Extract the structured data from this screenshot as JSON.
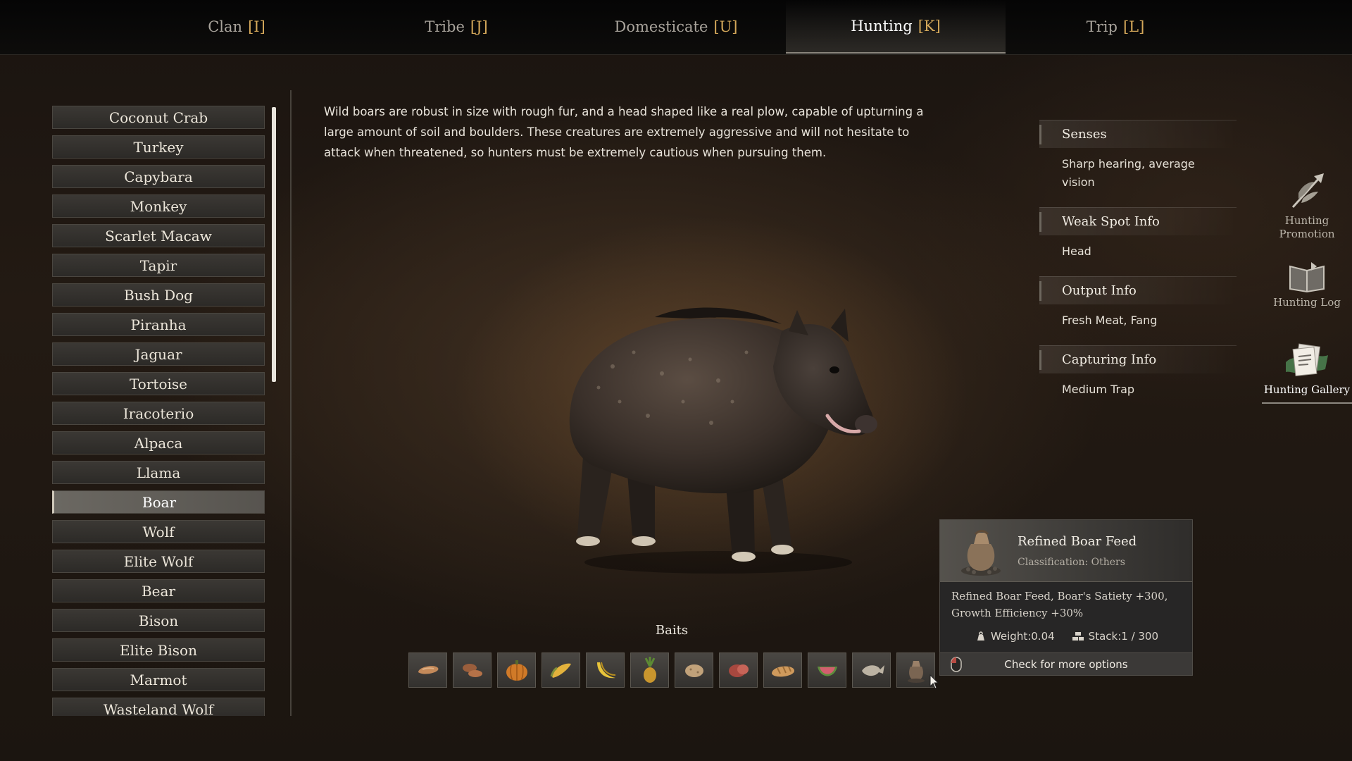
{
  "tabs": [
    {
      "label": "Clan",
      "key": "[I]",
      "active": false
    },
    {
      "label": "Tribe",
      "key": "[J]",
      "active": false
    },
    {
      "label": "Domesticate",
      "key": "[U]",
      "active": false
    },
    {
      "label": "Hunting",
      "key": "[K]",
      "active": true
    },
    {
      "label": "Trip",
      "key": "[L]",
      "active": false
    }
  ],
  "animals": [
    "Coconut Crab",
    "Turkey",
    "Capybara",
    "Monkey",
    "Scarlet Macaw",
    "Tapir",
    "Bush Dog",
    "Piranha",
    "Jaguar",
    "Tortoise",
    "Iracoterio",
    "Alpaca",
    "Llama",
    "Boar",
    "Wolf",
    "Elite Wolf",
    "Bear",
    "Bison",
    "Elite Bison",
    "Marmot",
    "Wasteland Wolf"
  ],
  "selected_animal": "Boar",
  "description": "Wild boars are robust in size with rough fur, and a head shaped like a real plow, capable of upturning a large amount of soil and boulders. These creatures are extremely aggressive and will not hesitate to attack when threatened, so hunters must be extremely cautious when pursuing them.",
  "info": {
    "senses": {
      "title": "Senses",
      "value": "Sharp hearing, average vision"
    },
    "weak_spot": {
      "title": "Weak Spot Info",
      "value": "Head"
    },
    "output": {
      "title": "Output Info",
      "value": "Fresh Meat, Fang"
    },
    "capturing": {
      "title": "Capturing Info",
      "value": "Medium Trap"
    }
  },
  "side_buttons": {
    "promotion": "Hunting Promotion",
    "log": "Hunting Log",
    "gallery": "Hunting Gallery"
  },
  "baits": {
    "title": "Baits",
    "items": [
      "sausage-icon",
      "sweet-potato-icon",
      "pumpkin-icon",
      "corn-icon",
      "banana-icon",
      "pineapple-icon",
      "potato-icon",
      "meat-icon",
      "bread-icon",
      "melon-icon",
      "fish-icon",
      "feed-bag-icon"
    ]
  },
  "tooltip": {
    "name": "Refined Boar Feed",
    "classification": "Classification: Others",
    "description": "Refined Boar Feed, Boar's Satiety +300, Growth Efficiency +30%",
    "weight": "Weight:0.04",
    "stack": "Stack:1 / 300",
    "action": "Check for more options"
  },
  "colors": {
    "accent_key": "#d4a85a",
    "background": "#231a13",
    "panel": "#3b3834"
  }
}
